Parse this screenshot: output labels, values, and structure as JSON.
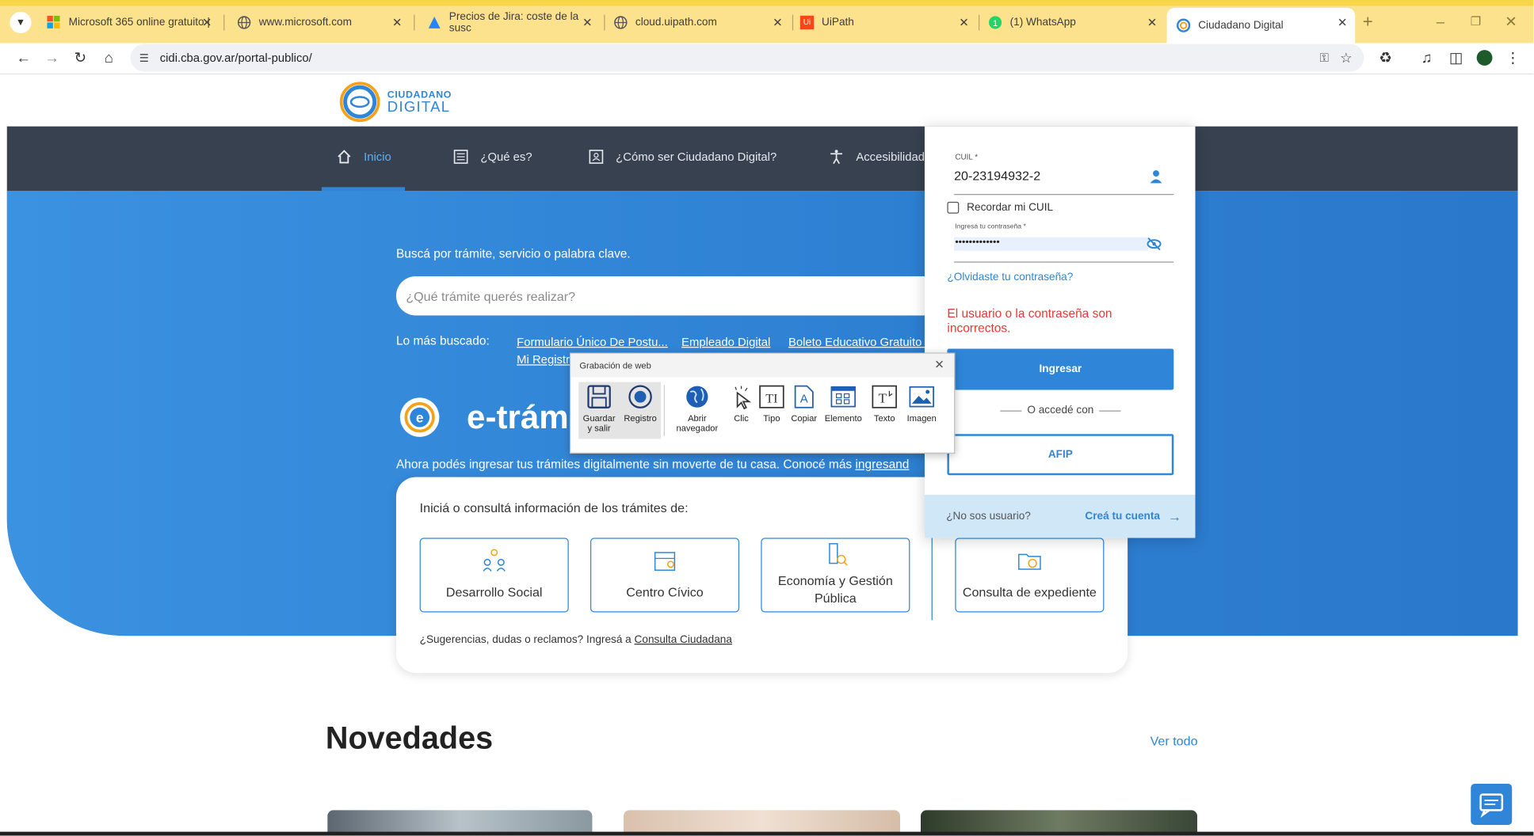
{
  "browser": {
    "tabs": [
      {
        "label": "Microsoft 365 online gratuito |",
        "icon": "microsoft-icon"
      },
      {
        "label": "www.microsoft.com",
        "icon": "globe-icon"
      },
      {
        "label": "Precios de Jira: coste de la susc",
        "icon": "jira-icon"
      },
      {
        "label": "cloud.uipath.com",
        "icon": "globe-icon"
      },
      {
        "label": "UiPath",
        "icon": "uipath-icon"
      },
      {
        "label": "(1) WhatsApp",
        "icon": "whatsapp-icon"
      },
      {
        "label": "Ciudadano Digital",
        "icon": "cidi-icon",
        "active": true
      }
    ],
    "url": "cidi.cba.gov.ar/portal-publico/"
  },
  "brand": {
    "line1": "CIUDADANO",
    "line2": "DIGITAL"
  },
  "nav": {
    "inicio": "Inicio",
    "que_es": "¿Qué es?",
    "como_ser": "¿Cómo ser Ciudadano Digital?",
    "accesibilidad": "Accesibilidad"
  },
  "hero": {
    "search_label": "Buscá por trámite, servicio o palabra clave.",
    "search_placeholder": "¿Qué trámite querés realizar?",
    "most_searched_label": "Lo más buscado:",
    "most_searched": [
      "Formulario Único De Postu...",
      "Empleado Digital",
      "Boleto Educativo Gratuito (...",
      "Mi Registro"
    ],
    "etramites_title": "e-trám",
    "intro_text": "Ahora podés ingresar tus trámites digitalmente sin moverte de tu casa. Conocé más ",
    "intro_link": "ingresand"
  },
  "tramites": {
    "heading": "Iniciá o consultá información de los trámites de:",
    "cards": [
      "Desarrollo Social",
      "Centro Cívico",
      "Economía y Gestión Pública",
      "Consulta de expediente"
    ],
    "suggestions": "¿Sugerencias, dudas o reclamos? Ingresá a ",
    "suggestions_link": "Consulta Ciudadana"
  },
  "novedades": {
    "title": "Novedades",
    "ver_todo": "Ver todo"
  },
  "login": {
    "cuil_label": "CUIL *",
    "cuil_value": "20-23194932-2",
    "remember": "Recordar mi CUIL",
    "password_label": "Ingresá tu contraseña *",
    "password_value": "•••••••••••••",
    "forgot": "¿Olvidaste tu contraseña?",
    "error": "El usuario o la contraseña son incorrectos.",
    "submit": "Ingresar",
    "or_access": "O accedé con",
    "afip": "AFIP",
    "no_user": "¿No sos usuario?",
    "create": "Creá tu cuenta"
  },
  "recorder": {
    "title": "Grabación de web",
    "buttons": [
      {
        "label": "Guardar y salir",
        "icon": "save-icon"
      },
      {
        "label": "Registro",
        "icon": "record-icon"
      },
      {
        "label": "Abrir navegador",
        "icon": "globe-icon"
      },
      {
        "label": "Clic",
        "icon": "click-icon"
      },
      {
        "label": "Tipo",
        "icon": "type-icon"
      },
      {
        "label": "Copiar",
        "icon": "copy-icon"
      },
      {
        "label": "Elemento",
        "icon": "element-icon"
      },
      {
        "label": "Texto",
        "icon": "text-icon"
      },
      {
        "label": "Imagen",
        "icon": "image-icon"
      }
    ]
  },
  "colors": {
    "accent": "#2f86d8",
    "nav_bg": "#37414f",
    "error": "#e53935",
    "tabbar": "#fde28d"
  }
}
